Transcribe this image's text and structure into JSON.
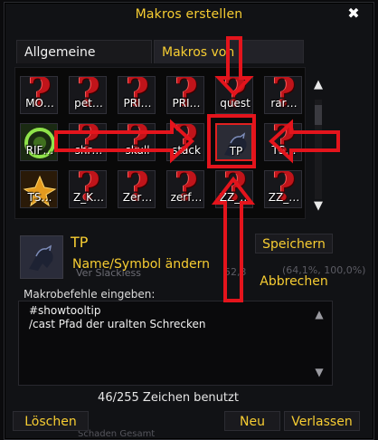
{
  "window": {
    "title": "Makros erstellen",
    "close_glyph": "✖"
  },
  "tabs": [
    {
      "label": "Allgemeine Makros",
      "active": false
    },
    {
      "label": "Makros von Slackless",
      "active": true
    }
  ],
  "macros": [
    {
      "label": "MO…",
      "icon": "question-mark-icon"
    },
    {
      "label": "pet…",
      "icon": "question-mark-icon"
    },
    {
      "label": "PRI…",
      "icon": "question-mark-icon"
    },
    {
      "label": "PRI…",
      "icon": "question-mark-icon"
    },
    {
      "label": "quest",
      "icon": "question-mark-icon"
    },
    {
      "label": "rar…",
      "icon": "question-mark-icon"
    },
    {
      "label": "RIF…",
      "icon": "green-swirl-icon"
    },
    {
      "label": "shr…",
      "icon": "question-mark-icon"
    },
    {
      "label": "skull",
      "icon": "question-mark-icon"
    },
    {
      "label": "stack",
      "icon": "question-mark-icon"
    },
    {
      "label": "TP",
      "icon": "raven-icon",
      "selected": true
    },
    {
      "label": "TS…",
      "icon": "question-mark-icon"
    },
    {
      "label": "TS…",
      "icon": "golden-flower-icon"
    },
    {
      "label": "Z_K…",
      "icon": "question-mark-icon"
    },
    {
      "label": "Zer…",
      "icon": "question-mark-icon"
    },
    {
      "label": "zerf…",
      "icon": "question-mark-icon"
    },
    {
      "label": "ZZ_…",
      "icon": "question-mark-icon"
    },
    {
      "label": "ZZ_…",
      "icon": "question-mark-icon"
    }
  ],
  "scroll": {
    "up": "▲",
    "down": "▼"
  },
  "selected": {
    "name": "TP",
    "icon": "raven-icon",
    "rename_label": "Name/Symbol ändern",
    "save_label": "Speichern",
    "cancel_label": "Abbrechen"
  },
  "background_text": {
    "line1": "Ver  Slackless",
    "line2": "(64,1%, 100,0%)",
    "line3": "52,3",
    "line4": "Schaden Gesamt"
  },
  "editor": {
    "label": "Makrobefehle eingeben:",
    "content": "#showtooltip\n/cast Pfad der uralten Schrecken"
  },
  "char_count": "46/255 Zeichen benutzt",
  "footer": {
    "delete_label": "Löschen",
    "new_label": "Neu",
    "exit_label": "Verlassen"
  },
  "colors": {
    "accent": "#f7cd32",
    "annotation": "#e4141c",
    "icon_red": "#c0141a"
  }
}
